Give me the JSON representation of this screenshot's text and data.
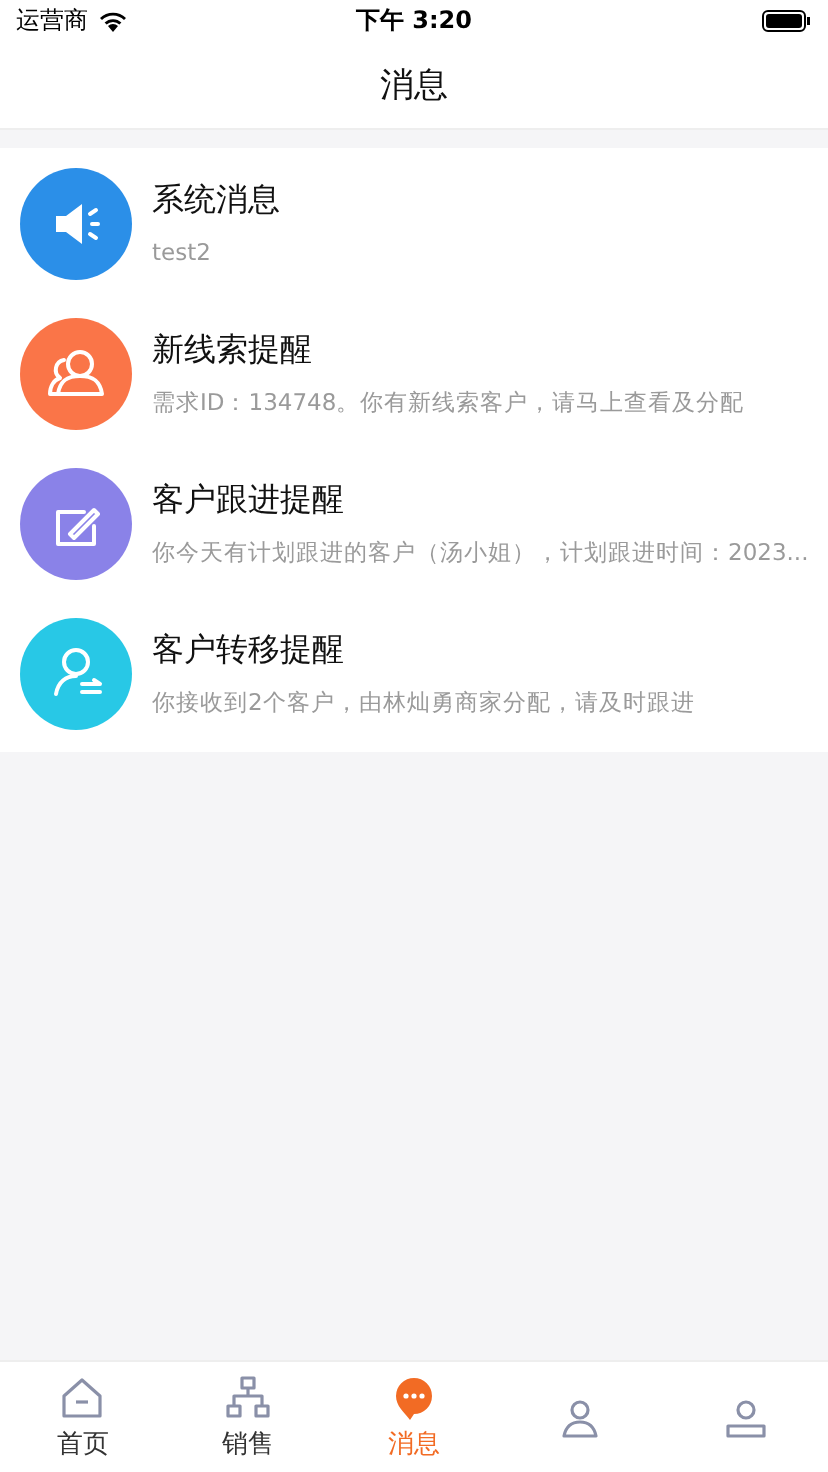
{
  "status_bar": {
    "carrier": "运营商",
    "time": "下午 3:20"
  },
  "nav": {
    "title": "消息"
  },
  "messages": [
    {
      "kind": "system",
      "title": "系统消息",
      "preview": "test2",
      "color": "#2b8fe8"
    },
    {
      "kind": "lead",
      "title": "新线索提醒",
      "preview": "需求ID：134748。你有新线索客户，请马上查看及分配",
      "color": "#fa7548"
    },
    {
      "kind": "followup",
      "title": "客户跟进提醒",
      "preview": "你今天有计划跟进的客户（汤小姐），计划跟进时间：2023...",
      "color": "#8a82e8"
    },
    {
      "kind": "transfer",
      "title": "客户转移提醒",
      "preview": "你接收到2个客户，由林灿勇商家分配，请及时跟进",
      "color": "#28c8e6"
    }
  ],
  "tabs": [
    {
      "kind": "home",
      "label": "首页",
      "selected": false
    },
    {
      "kind": "sales",
      "label": "销售",
      "selected": false
    },
    {
      "kind": "messages",
      "label": "消息",
      "selected": true
    },
    {
      "kind": "customers",
      "selected": false
    },
    {
      "kind": "mine",
      "selected": false
    }
  ]
}
